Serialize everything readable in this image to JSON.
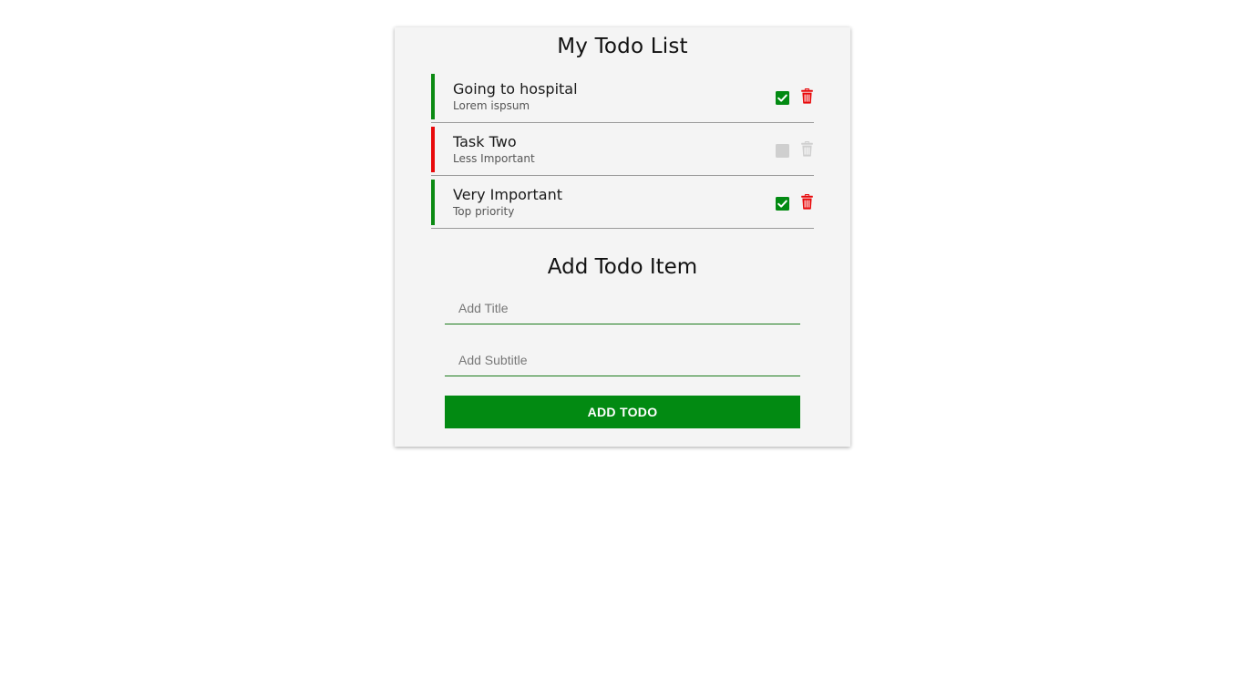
{
  "app": {
    "heading": "My Todo List"
  },
  "todos": [
    {
      "title": "Going to hospital",
      "subtitle": "Lorem ispsum",
      "priority_color": "#0b8a12",
      "completed": true,
      "check_icon": "checked-checkbox-icon",
      "delete_icon": "trash-icon",
      "delete_enabled": true
    },
    {
      "title": "Task Two",
      "subtitle": "Less Important",
      "priority_color": "#e8090b",
      "completed": false,
      "check_icon": "unchecked-checkbox-icon",
      "delete_icon": "trash-icon",
      "delete_enabled": false
    },
    {
      "title": "Very Important",
      "subtitle": "Top priority",
      "priority_color": "#0b8a12",
      "completed": true,
      "check_icon": "checked-checkbox-icon",
      "delete_icon": "trash-icon",
      "delete_enabled": true
    }
  ],
  "add_form": {
    "heading": "Add Todo Item",
    "title_placeholder": "Add Title",
    "title_value": "",
    "subtitle_placeholder": "Add Subtitle",
    "subtitle_value": "",
    "submit_label": "ADD TODO"
  },
  "colors": {
    "accent_green": "#028a12",
    "delete_red": "#e8090b",
    "disabled_gray": "#cfcfcf",
    "card_bg": "#f4f4f4"
  }
}
